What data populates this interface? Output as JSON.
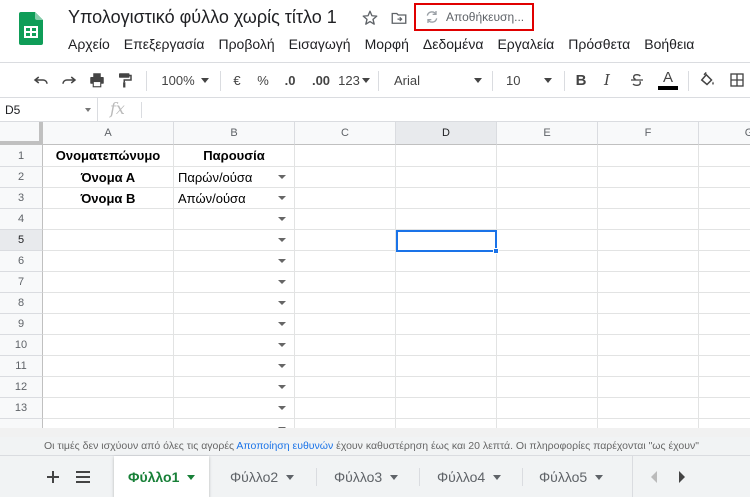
{
  "header": {
    "title": "Υπολογιστικό φύλλο χωρίς τίτλο 1",
    "saving_status": "Αποθήκευση...",
    "menu": [
      "Αρχείο",
      "Επεξεργασία",
      "Προβολή",
      "Εισαγωγή",
      "Μορφή",
      "Δεδομένα",
      "Εργαλεία",
      "Πρόσθετα",
      "Βοήθεια"
    ]
  },
  "toolbar": {
    "zoom": "100%",
    "currency": "€",
    "percent": "%",
    "decrease_decimal": ".0",
    "increase_decimal": ".00",
    "more_formats": "123",
    "font": "Arial",
    "font_size": "10",
    "bold": "B",
    "italic": "I",
    "text_color_letter": "A"
  },
  "formula_bar": {
    "cell_ref": "D5",
    "fx": "fx"
  },
  "grid": {
    "columns": [
      "A",
      "B",
      "C",
      "D",
      "E",
      "F",
      "G"
    ],
    "rows": [
      "1",
      "2",
      "3",
      "4",
      "5",
      "6",
      "7",
      "8",
      "9",
      "10",
      "11",
      "12",
      "13"
    ],
    "header_row": {
      "a": "Ονοματεπώνυμο",
      "b": "Παρουσία"
    },
    "data": [
      {
        "a": "Όνομα Α",
        "b": "Παρών/ούσα"
      },
      {
        "a": "Όνομα Β",
        "b": "Απών/ούσα"
      }
    ],
    "active_cell": "D5"
  },
  "notice": {
    "text_before": "Οι τιμές δεν ισχύουν από όλες τις αγορές ",
    "link": "Αποποίηση ευθυνών",
    "text_after": " έχουν καθυστέρηση έως και 20 λεπτά. Οι πληροφορίες παρέχονται \"ως έχουν\""
  },
  "tabs": {
    "sheets": [
      "Φύλλο1",
      "Φύλλο2",
      "Φύλλο3",
      "Φύλλο4",
      "Φύλλο5"
    ],
    "active": "Φύλλο1"
  },
  "colors": {
    "accent": "#1a73e8",
    "sheets_green": "#188038",
    "highlight_red": "#e00000"
  }
}
